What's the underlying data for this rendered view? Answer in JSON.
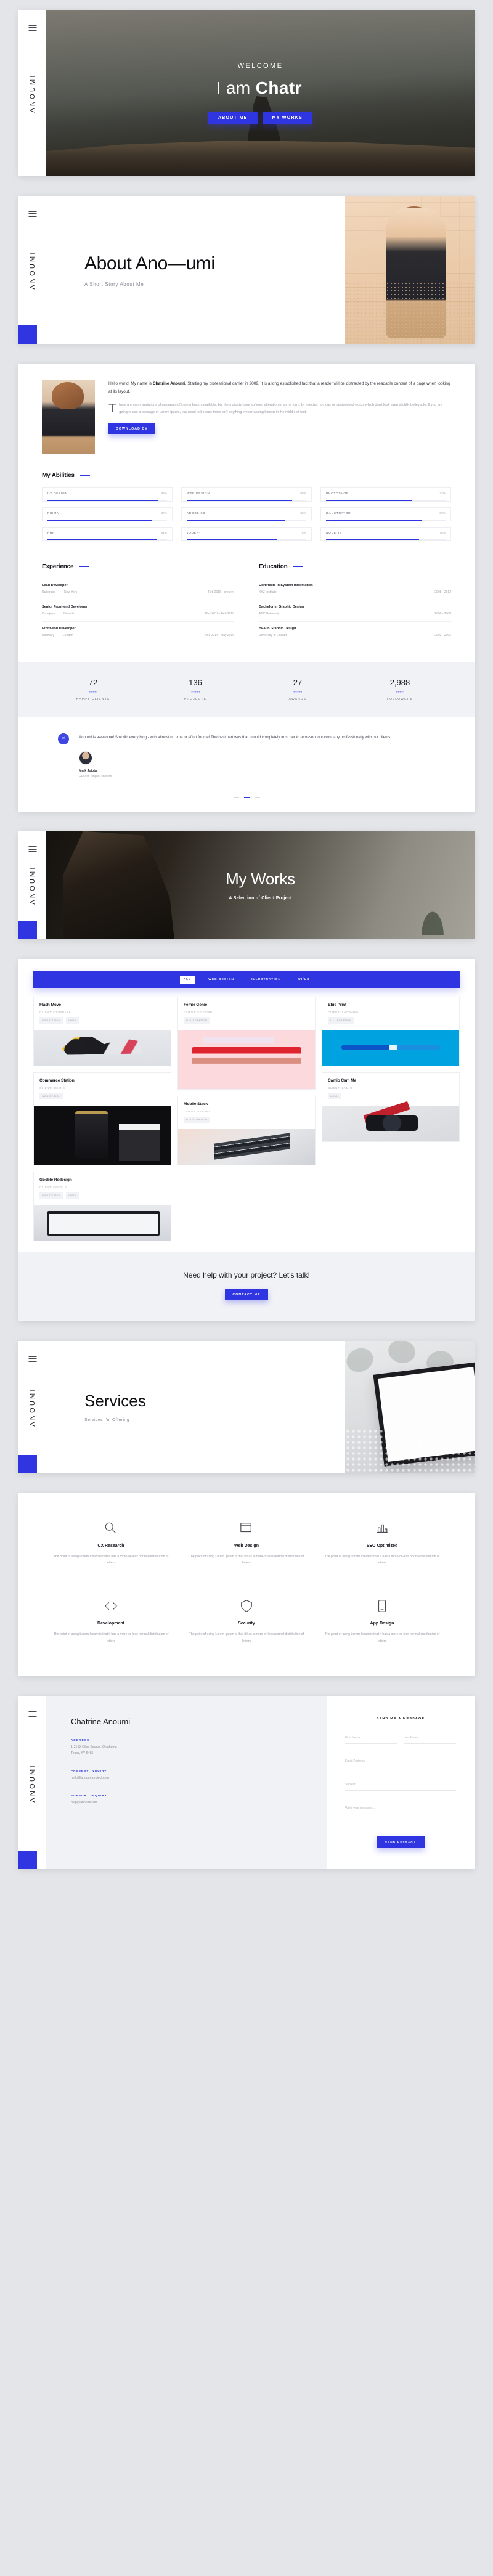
{
  "brand": {
    "rail_name": "ANOUMI",
    "menu_icon": "hamburger-icon"
  },
  "hero": {
    "welcome": "WELCOME",
    "title_prefix": "I am ",
    "title_name": "Chatr",
    "btn_about": "ABOUT ME",
    "btn_works": "MY WORKS"
  },
  "about_hero": {
    "title": "About Ano—umi",
    "subtitle": "A Short Story About Me"
  },
  "about": {
    "p1_pre": "Hello world! My name is ",
    "p1_name": "Chatrine Anoumi",
    "p1_post": ". Starting my professional carrier in 2009. It is a long established fact that a reader will be distracted by the readable content of a page when looking at its layout.",
    "p2": "There are many variations of passages of Lorem Ipsum available, but the majority have suffered alteration in some form, by injected humour, or randomised words which don't look even slightly believable. If you are going to use a passage of Lorem Ipsum, you need to be sure there isn't anything embarrassing hidden in the middle of text.",
    "cv_button": "DOWNLOAD CV"
  },
  "abilities": {
    "heading": "My Abilities",
    "items": [
      {
        "name": "UX DESIGN",
        "pct": "93%",
        "value": 93
      },
      {
        "name": "WEB DESIGN",
        "pct": "88%",
        "value": 88
      },
      {
        "name": "PHOTOSHOP",
        "pct": "72%",
        "value": 72
      },
      {
        "name": "FIGMA",
        "pct": "87%",
        "value": 87
      },
      {
        "name": "ADOBE XD",
        "pct": "82%",
        "value": 82
      },
      {
        "name": "ILLUSTRATOR",
        "pct": "80%",
        "value": 80
      },
      {
        "name": "PHP",
        "pct": "91%",
        "value": 91
      },
      {
        "name": "JQUERY",
        "pct": "76%",
        "value": 76
      },
      {
        "name": "NODE JS",
        "pct": "78%",
        "value": 78
      }
    ]
  },
  "experience": {
    "heading": "Experience",
    "items": [
      {
        "title": "Lead Developer",
        "org": "Ruberube",
        "place": "New York",
        "date": "Feb 2018 - present"
      },
      {
        "title": "Senior Front-end Developer",
        "org": "Codejoyn",
        "place": "Nevada",
        "date": "May 2016 - Feb 2018"
      },
      {
        "title": "Front-end Developer",
        "org": "Rotimary",
        "place": "London",
        "date": "Dec 2014 - May 2016"
      }
    ]
  },
  "education": {
    "heading": "Education",
    "items": [
      {
        "title": "Certificate in System Information",
        "org": "XYZ Institute",
        "place": "",
        "date": "2008 - 2012"
      },
      {
        "title": "Bachelor in Graphic Design",
        "org": "ABC University",
        "place": "",
        "date": "2006 - 2008"
      },
      {
        "title": "BFA in Graphic Design",
        "org": "University of Loksum",
        "place": "",
        "date": "2003 - 2006"
      }
    ]
  },
  "counters": [
    {
      "number": "72",
      "label": "HAPPY CLIENTS"
    },
    {
      "number": "136",
      "label": "PROJECTS"
    },
    {
      "number": "27",
      "label": "AWARDS"
    },
    {
      "number": "2,988",
      "label": "FOLLOWERS"
    }
  ],
  "testimonial": {
    "quote_mark": "“",
    "quote": "Anoumi is awesome! She did everything - with almost no time or effort for me! The best part was that I could completely trust her to represent our company professionally with our clients.",
    "author": "Mark Jojoba",
    "role": "CEO of Tongkol chicken"
  },
  "works_hero": {
    "title": "My Works",
    "subtitle": "A Selection of Client Project"
  },
  "portfolio": {
    "filters": [
      "ALL",
      "WEB DESIGN",
      "ILLUSTRATION",
      "UI/UX"
    ],
    "active_filter": "ALL",
    "items": [
      {
        "title": "Flash Move",
        "client": "CLIENT: OTOSPARK",
        "tags": [
          "WEB DESIGN",
          "UI/UX"
        ],
        "thumb": "shoes-image",
        "tall": false
      },
      {
        "title": "Femie Genie",
        "client": "CLIENT: FG CORP",
        "tags": [
          "ILLUSTRATION"
        ],
        "thumb": "pink-image",
        "tall": true
      },
      {
        "title": "Blue Print",
        "client": "CLIENT: SNOWMAN",
        "tags": [
          "ILLUSTRATION"
        ],
        "thumb": "blue-image",
        "tall": false
      },
      {
        "title": "Commerce Station",
        "client": "CLIENT: CM INC",
        "tags": [
          "WEB DESIGN"
        ],
        "thumb": "dark-image",
        "tall": true
      },
      {
        "title": "Mobile Stack",
        "client": "CLIENT: BANANA",
        "tags": [
          "ILLUSTRATION"
        ],
        "thumb": "mobile-image",
        "tall": false
      },
      {
        "title": "Camio Cam Me",
        "client": "CLIENT: CAMIO",
        "tags": [
          "UI/UX"
        ],
        "thumb": "camera-image",
        "tall": false
      },
      {
        "title": "Gooble Redesign",
        "client": "CLIENT: GOOBLE",
        "tags": [
          "WEB DESIGN",
          "UI/UX"
        ],
        "thumb": "laptop-image",
        "tall": false
      }
    ]
  },
  "cta": {
    "heading": "Need help with your project? Let's talk!",
    "button": "CONTACT ME"
  },
  "services_hero": {
    "title": "Services",
    "subtitle": "Services I'm Offering"
  },
  "services": [
    {
      "icon": "magnifier-icon",
      "title": "UX Research",
      "desc": "The point of using Lorem Ipsum is that it has a more-or-less normal distribution of letters"
    },
    {
      "icon": "browser-icon",
      "title": "Web Design",
      "desc": "The point of using Lorem Ipsum is that it has a more-or-less normal distribution of letters"
    },
    {
      "icon": "chart-icon",
      "title": "SEO Optimized",
      "desc": "The point of using Lorem Ipsum is that it has a more-or-less normal distribution of letters"
    },
    {
      "icon": "code-icon",
      "title": "Development",
      "desc": "The point of using Lorem Ipsum is that it has a more-or-less normal distribution of letters"
    },
    {
      "icon": "shield-icon",
      "title": "Security",
      "desc": "The point of using Lorem Ipsum is that it has a more-or-less normal distribution of letters"
    },
    {
      "icon": "mobile-icon",
      "title": "App Design",
      "desc": "The point of using Lorem Ipsum is that it has a more-or-less normal distribution of letters"
    }
  ],
  "contact": {
    "name": "Chatrine Anoumi",
    "blocks": [
      {
        "label": "ADDRESS",
        "value": "1-21 St Giles Square, Oklahoma\nTexas, KY 6485"
      },
      {
        "label": "PROJECT INQUIRY",
        "value": "hello@anoumi-project.com"
      },
      {
        "label": "SUPPORT INQUIRY",
        "value": "help@anoumi.com"
      }
    ],
    "form": {
      "heading": "SEND ME A MESSAGE",
      "first_name_placeholder": "First Name",
      "last_name_placeholder": "Last Name",
      "email_placeholder": "Email Address",
      "subject_placeholder": "Subject",
      "message_placeholder": "Write your message...",
      "submit": "SEND MESSAGE"
    }
  },
  "colors": {
    "accent": "#2f35e0",
    "page_bg": "#e3e5e9",
    "panel_bg": "#f1f2f6"
  }
}
